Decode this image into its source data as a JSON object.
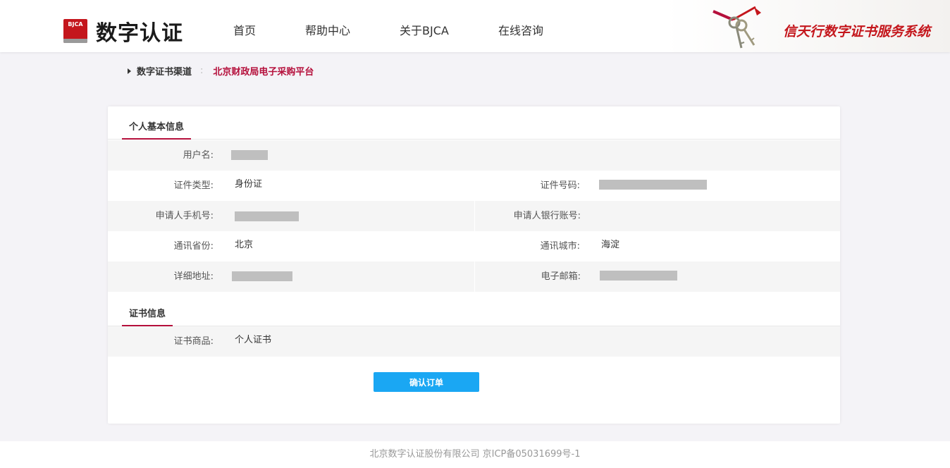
{
  "header": {
    "logo_badge": "BJCA",
    "logo_text": "数字认证",
    "nav": [
      "首页",
      "帮助中心",
      "关于BJCA",
      "在线咨询"
    ],
    "brand_title": "信天行数字证书服务系统"
  },
  "breadcrumb": {
    "label": "数字证书渠道",
    "separator": ":",
    "current": "北京财政局电子采购平台"
  },
  "personal_info": {
    "section_title": "个人基本信息",
    "username_label": "用户名:",
    "id_type_label": "证件类型:",
    "id_type_value": "身份证",
    "id_number_label": "证件号码:",
    "phone_label": "申请人手机号:",
    "bank_label": "申请人银行账号:",
    "province_label": "通讯省份:",
    "province_value": "北京",
    "city_label": "通讯城市:",
    "city_value": "海淀",
    "address_label": "详细地址:",
    "email_label": "电子邮箱:"
  },
  "cert_info": {
    "section_title": "证书信息",
    "product_label": "证书商品:",
    "product_value": "个人证书"
  },
  "actions": {
    "confirm_label": "确认订单"
  },
  "footer": {
    "text": "北京数字认证股份有限公司 京ICP备05031699号-1"
  },
  "colors": {
    "accent_red": "#b5103c",
    "button_blue": "#1aa7f3",
    "page_bg": "#f4f3f7"
  }
}
